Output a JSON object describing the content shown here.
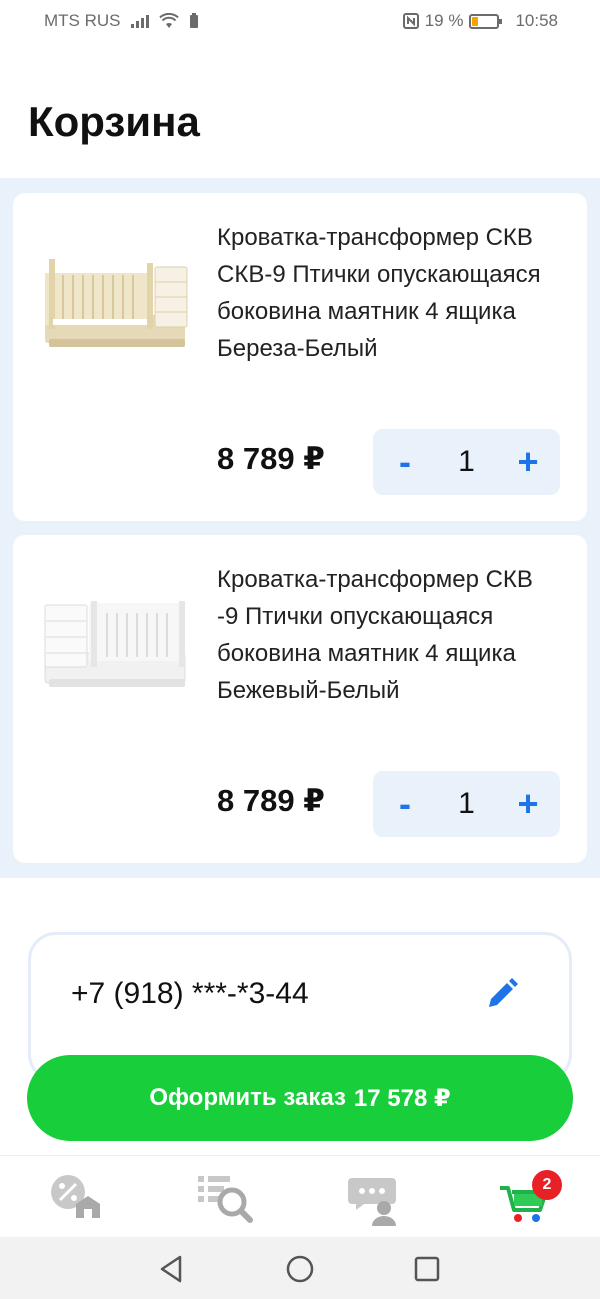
{
  "status_bar": {
    "carrier": "MTS RUS",
    "battery_percent": "19 %",
    "time": "10:58",
    "battery_level": 0.19
  },
  "page": {
    "title": "Корзина"
  },
  "cart_items": [
    {
      "name": "Кроватка-трансформер СКВ СКВ-9 Птички опускающаяся боковина маятник 4 ящика Береза-Белый",
      "price": "8 789 ₽",
      "quantity": "1",
      "minus_label": "-",
      "plus_label": "+"
    },
    {
      "name": "Кроватка-трансформер СКВ -9 Птички опускающаяся боковина маятник 4 ящика Бежевый-Белый",
      "price": "8 789 ₽",
      "quantity": "1",
      "minus_label": "-",
      "plus_label": "+"
    }
  ],
  "contact": {
    "phone": "+7 (918) ***-*3-44"
  },
  "checkout": {
    "label": "Оформить заказ",
    "total": "17 578 ₽"
  },
  "tab_bar": {
    "tabs": [
      {
        "icon": "discount-store-icon"
      },
      {
        "icon": "catalog-search-icon"
      },
      {
        "icon": "support-chat-icon"
      },
      {
        "icon": "cart-icon",
        "badge": "2",
        "active": true
      }
    ]
  },
  "colors": {
    "accent": "#1e73e8",
    "checkout": "#18cf3b",
    "badge": "#e82127",
    "cart_background": "#e9f1fb"
  }
}
